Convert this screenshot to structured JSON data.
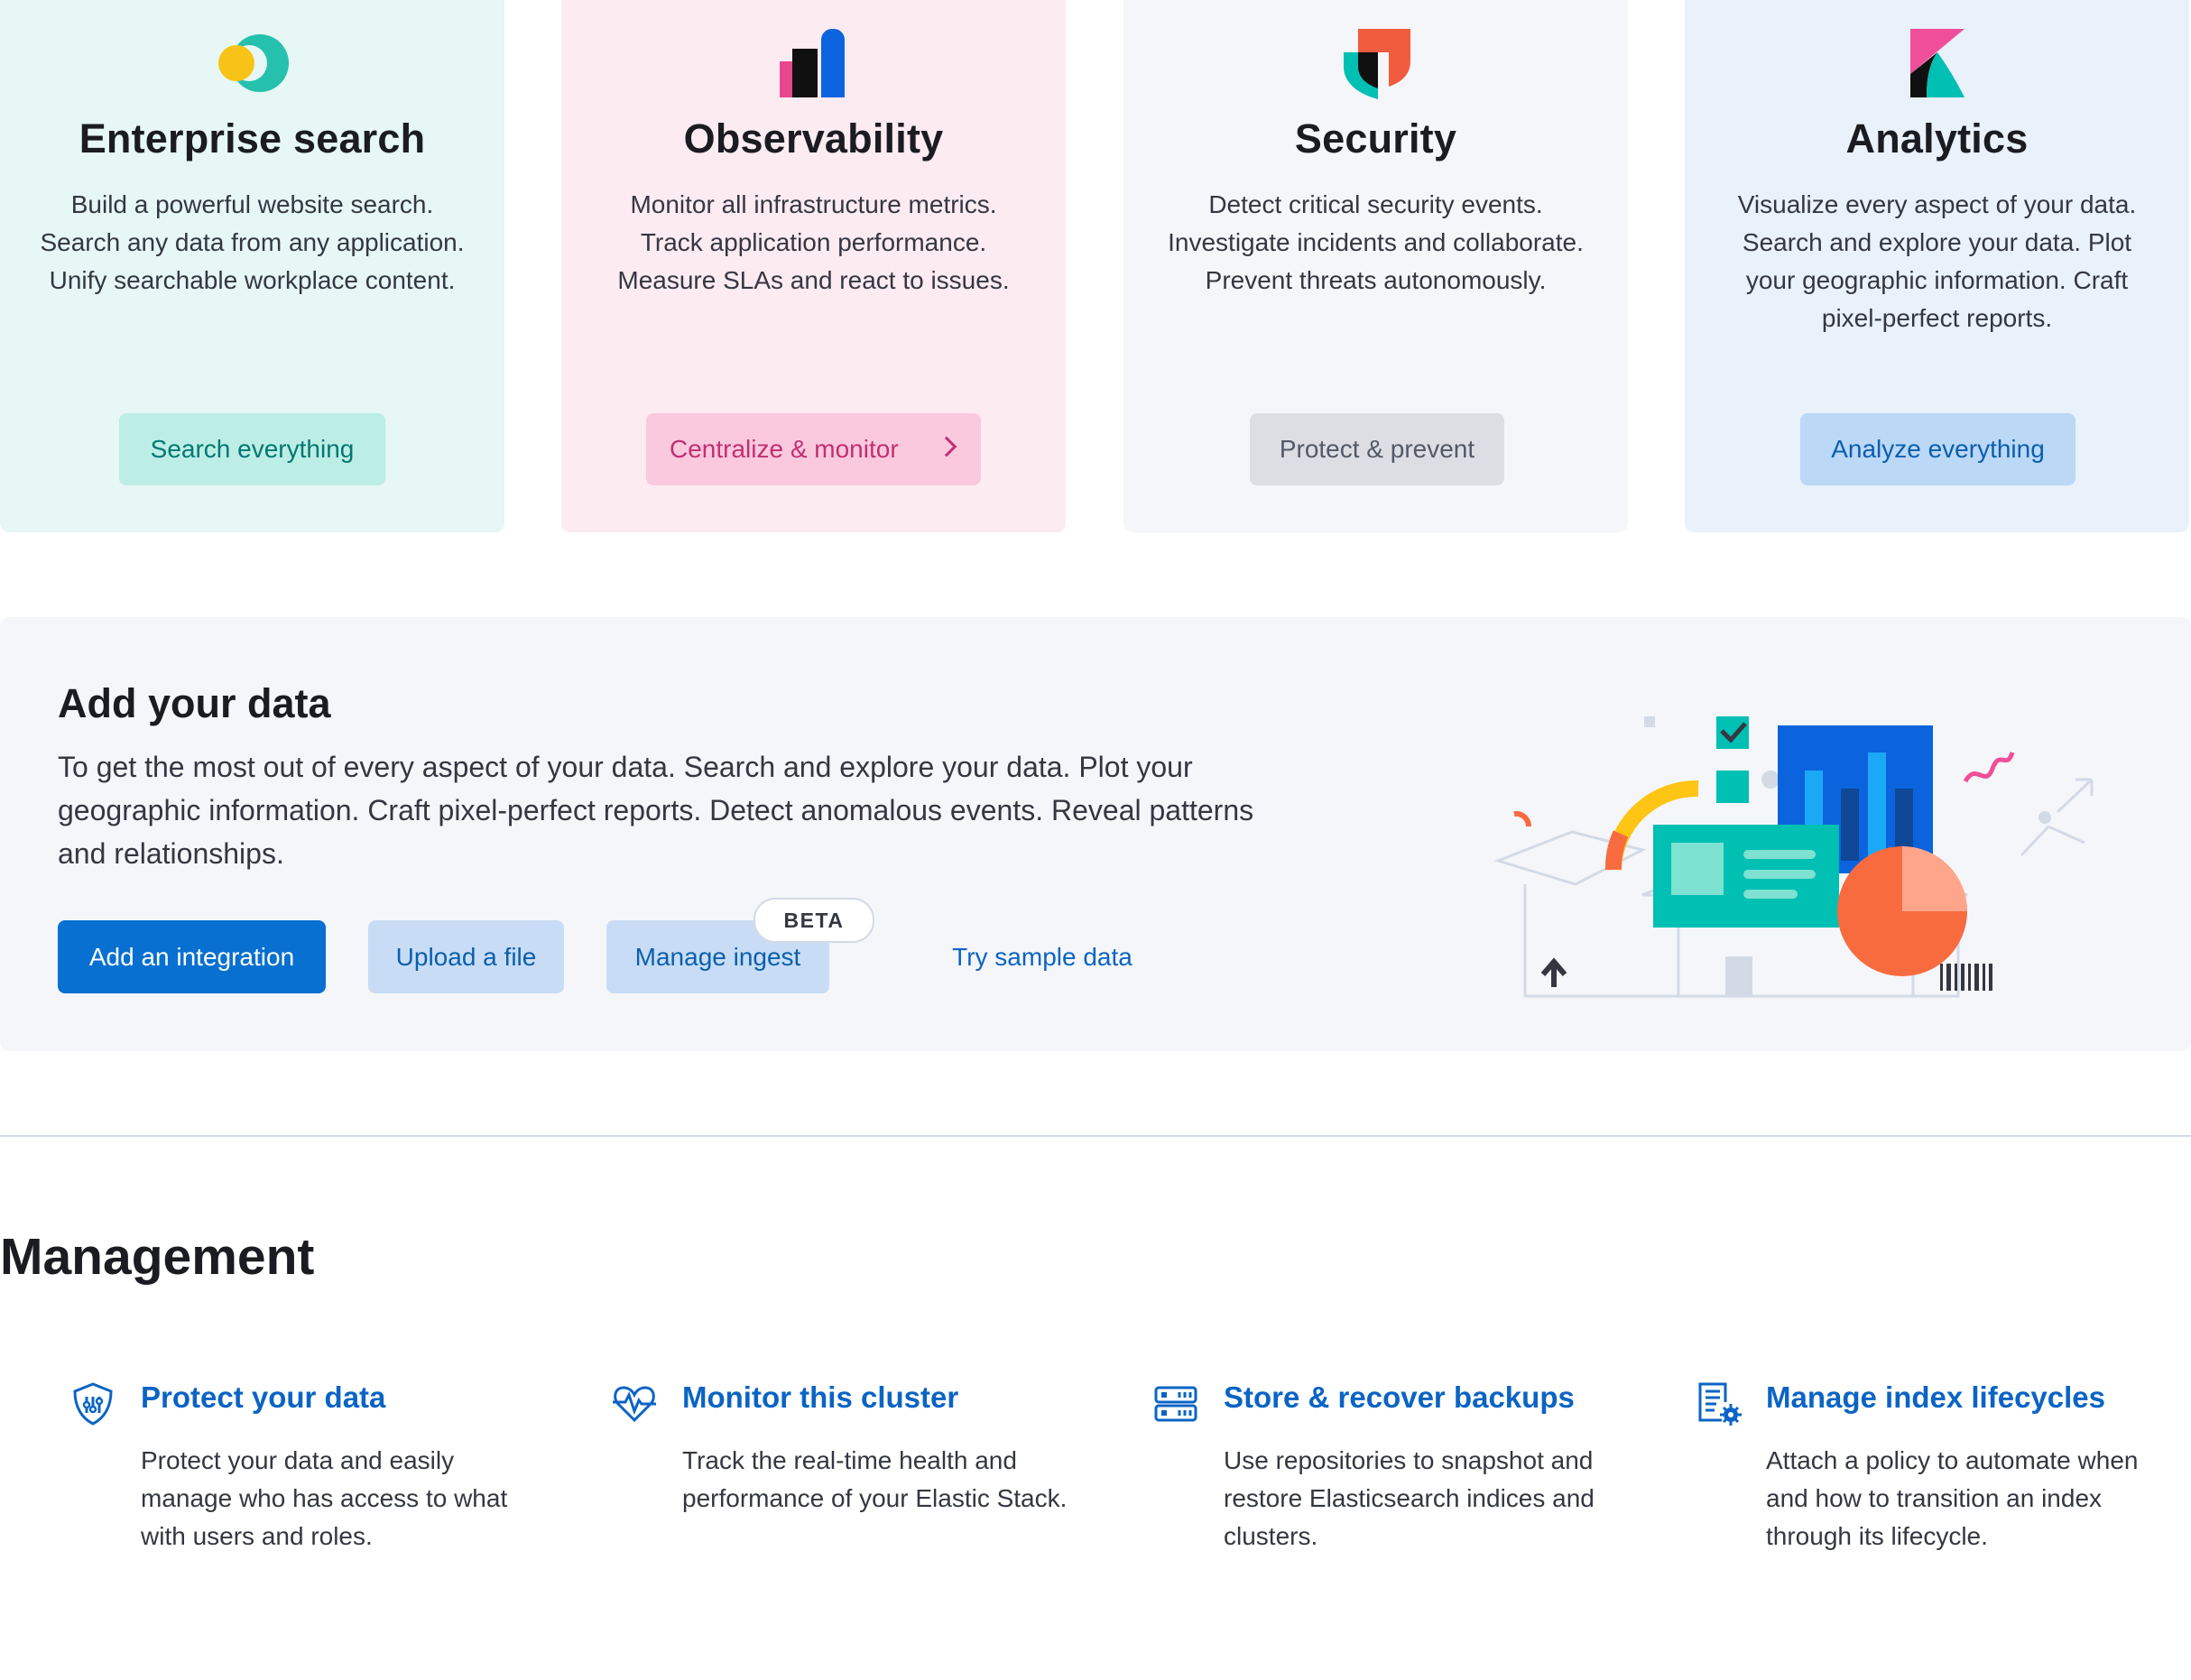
{
  "solutions": [
    {
      "title": "Enterprise search",
      "description": "Build a powerful website search. Search any data from any application. Unify searchable workplace content.",
      "button": "Search everything",
      "logo": "enterprise-search-logo"
    },
    {
      "title": "Observability",
      "description": "Monitor all infrastructure metrics. Track application performance. Measure SLAs and react to issues.",
      "button": "Centralize & monitor",
      "logo": "observability-logo"
    },
    {
      "title": "Security",
      "description": "Detect critical security events. Investigate incidents and collaborate. Prevent threats autonomously.",
      "button": "Protect & prevent",
      "logo": "security-logo"
    },
    {
      "title": "Analytics",
      "description": "Visualize every aspect of your data. Search and explore your data. Plot your geographic information. Craft pixel-perfect reports.",
      "button": "Analyze everything",
      "logo": "kibana-logo"
    }
  ],
  "add_data": {
    "heading": "Add your data",
    "body": "To get the most out of every aspect of your data. Search and explore your data. Plot your geographic information. Craft pixel-perfect reports. Detect anomalous events. Reveal patterns and relationships.",
    "buttons": {
      "integration": "Add an integration",
      "upload": "Upload a file",
      "ingest": "Manage ingest",
      "sample": "Try sample data"
    },
    "beta_badge": "BETA"
  },
  "management": {
    "title": "Management",
    "items": [
      {
        "title": "Protect your data",
        "description": "Protect your data and easily manage who has access to what with users and roles.",
        "icon": "shield-icon"
      },
      {
        "title": "Monitor this cluster",
        "description": "Track the real-time health and performance of your Elastic Stack.",
        "icon": "heartbeat-icon"
      },
      {
        "title": "Store & recover backups",
        "description": "Use repositories to snapshot and restore Elasticsearch indices and clusters.",
        "icon": "storage-icon"
      },
      {
        "title": "Manage index lifecycles",
        "description": "Attach a policy to automate when and how to transition an index through its lifecycle.",
        "icon": "index-settings-icon"
      }
    ]
  },
  "colors": {
    "primary": "#0770d0",
    "link": "#0b64c4",
    "enterprise_bg": "#e6f7f5",
    "observability_bg": "#fdebf2",
    "security_bg": "#f5f6f9",
    "analytics_bg": "#e9f1fa"
  }
}
